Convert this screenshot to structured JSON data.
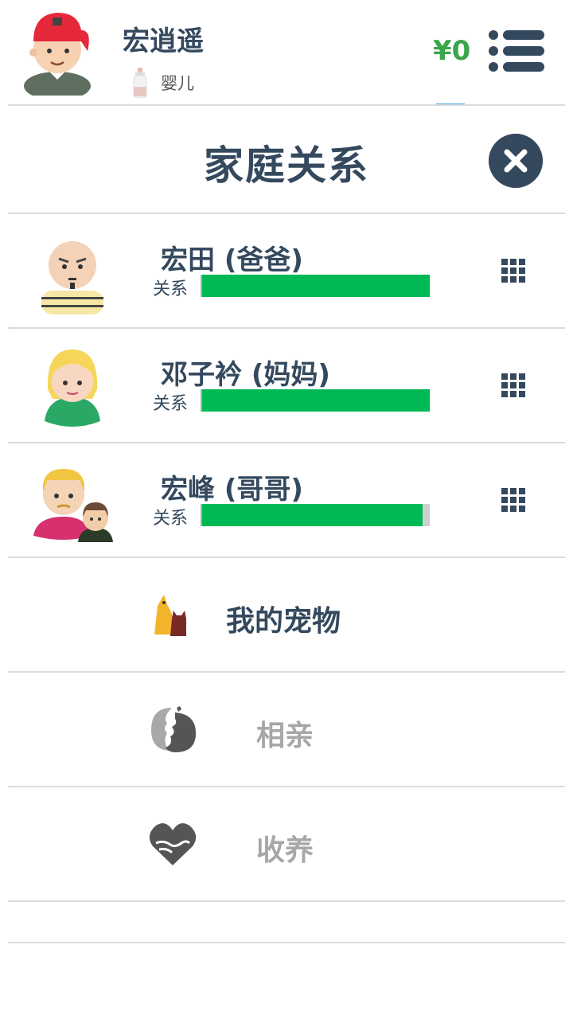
{
  "profile": {
    "name": "宏逍遥",
    "stage_label": "婴儿",
    "money": "¥0",
    "avatar_icon": "boy-red-cap-avatar",
    "stage_icon": "baby-bottle-icon"
  },
  "modal": {
    "title": "家庭关系",
    "close_icon": "close-icon"
  },
  "family": [
    {
      "name": "宏田 (爸爸)",
      "relation_label": "关系",
      "relation_fraction": 1.0,
      "avatar_icon": "bald-father-avatar"
    },
    {
      "name": "邓子衿 (妈妈)",
      "relation_label": "关系",
      "relation_fraction": 1.0,
      "avatar_icon": "blonde-mother-avatar"
    },
    {
      "name": "宏峰 (哥哥)",
      "relation_label": "关系",
      "relation_fraction": 0.97,
      "avatar_icon": "brother-avatar"
    }
  ],
  "options": [
    {
      "label": "我的宠物",
      "icon": "pet-dog-cat-icon",
      "enabled": true
    },
    {
      "label": "相亲",
      "icon": "kiss-faces-icon",
      "enabled": false
    },
    {
      "label": "收养",
      "icon": "heart-hands-icon",
      "enabled": false
    }
  ],
  "colors": {
    "primary": "#34495e",
    "money": "#3aa54a",
    "relation_bar": "#00b955",
    "disabled_text": "#a7a7a7"
  }
}
